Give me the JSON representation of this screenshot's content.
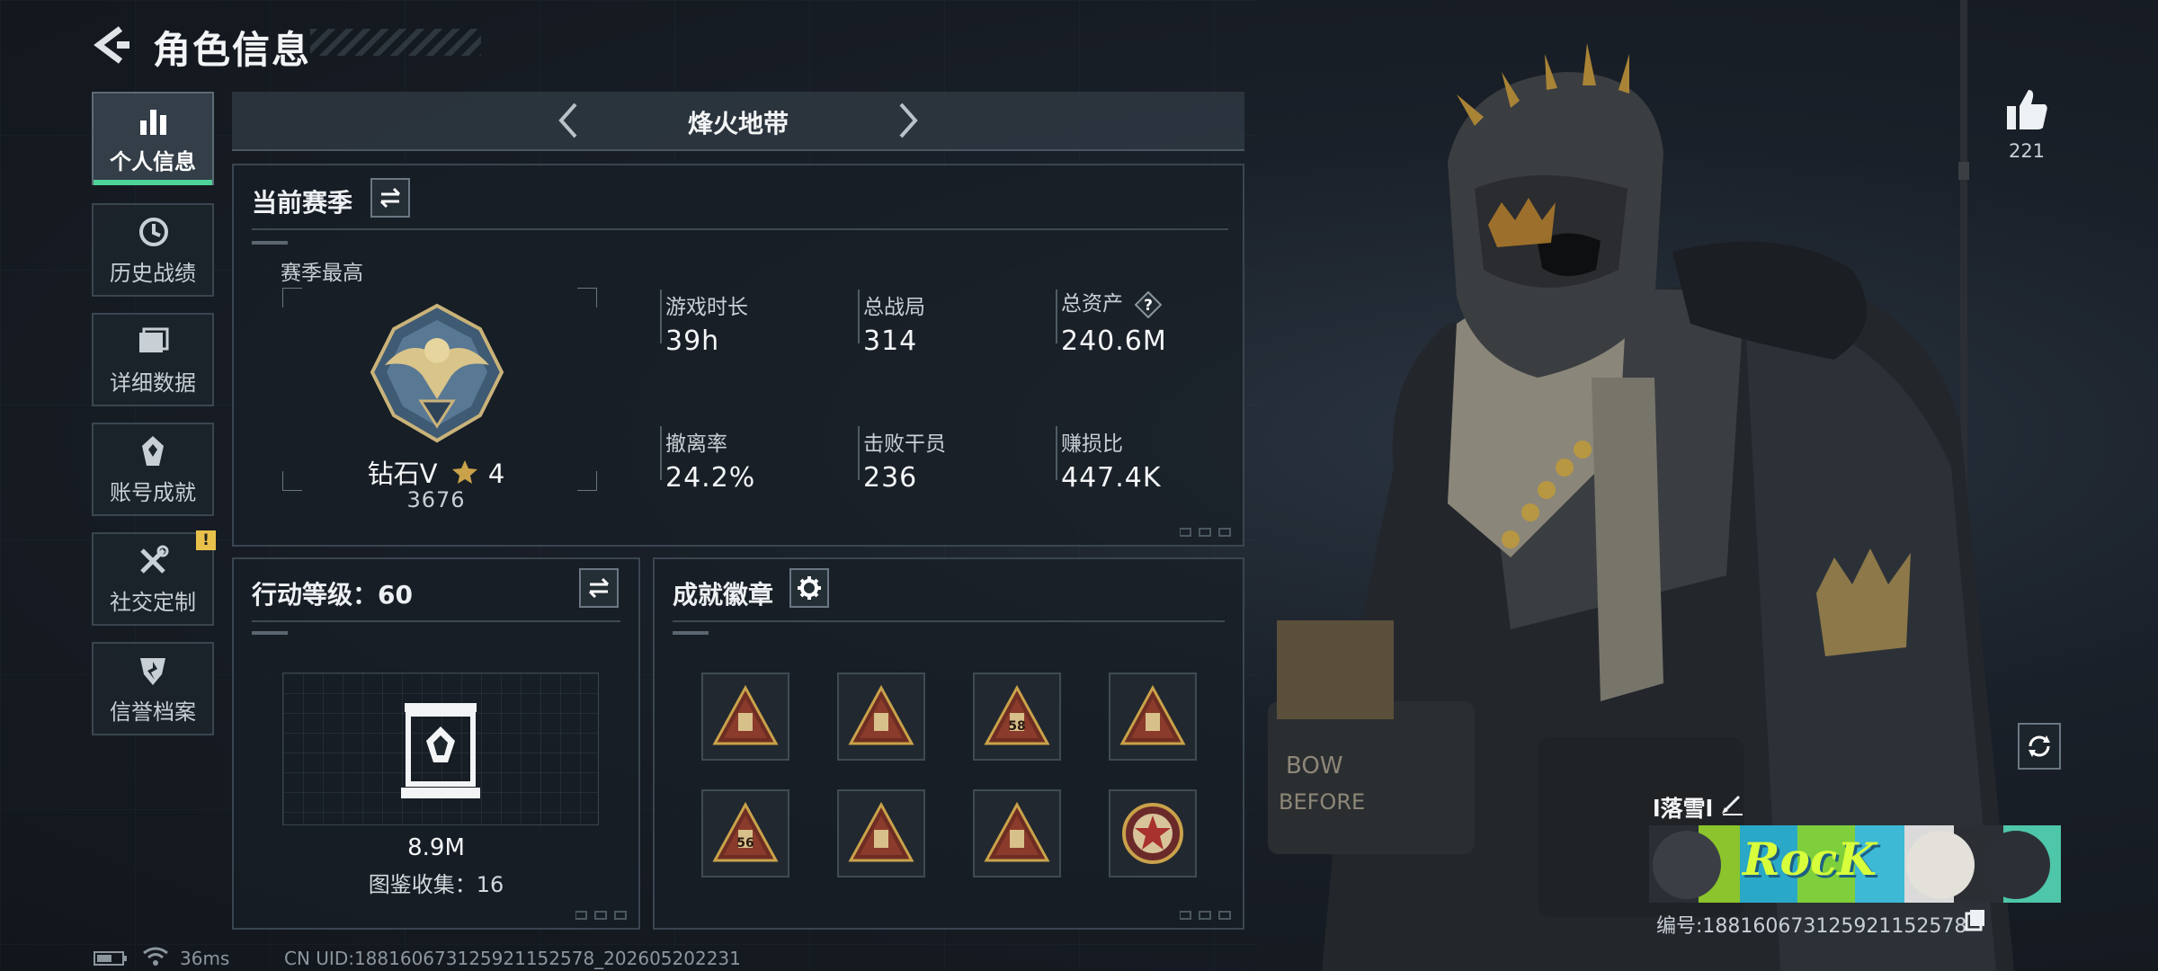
{
  "header": {
    "title": "角色信息"
  },
  "nav": {
    "items": [
      {
        "label": "个人信息",
        "icon": "bar-chart-icon",
        "active": true
      },
      {
        "label": "历史战绩",
        "icon": "clock-history-icon"
      },
      {
        "label": "详细数据",
        "icon": "folder-data-icon"
      },
      {
        "label": "账号成就",
        "icon": "achievement-icon"
      },
      {
        "label": "社交定制",
        "icon": "tools-icon",
        "badge": "!"
      },
      {
        "label": "信誉档案",
        "icon": "shield-icon"
      }
    ]
  },
  "mode": {
    "title": "烽火地带"
  },
  "season": {
    "title": "当前赛季",
    "best_label": "赛季最高",
    "rank_name": "钻石V",
    "rank_stars": "4",
    "rank_points": "3676",
    "stats": [
      {
        "label": "游戏时长",
        "value": "39h"
      },
      {
        "label": "总战局",
        "value": "314"
      },
      {
        "label": "总资产",
        "value": "240.6M",
        "help": "?"
      },
      {
        "label": "撤离率",
        "value": "24.2%"
      },
      {
        "label": "击败干员",
        "value": "236"
      },
      {
        "label": "赚损比",
        "value": "447.4K"
      }
    ]
  },
  "action_level": {
    "title": "行动等级：60",
    "value": "8.9M",
    "collection": "图鉴收集：16"
  },
  "achievements": {
    "title": "成就徽章",
    "badges": [
      "triangle-badge-icon",
      "triangle-badge-icon",
      "triangle-badge-icon",
      "triangle-badge-icon",
      "triangle-badge-icon",
      "triangle-badge-icon",
      "triangle-badge-icon",
      "round-star-badge-icon"
    ],
    "badge_labels": [
      "",
      "",
      "58",
      "",
      "56",
      "",
      "",
      ""
    ]
  },
  "profile": {
    "likes": "221",
    "player_name": "l落雪l",
    "banner_tag": "RocK",
    "player_id": "编号:1881606731259211525​78"
  },
  "status": {
    "ping": "36ms",
    "uid": "CN UID:1881606731259211525​78_202605202231"
  },
  "colors": {
    "accent": "#4fd39a",
    "warning": "#e8c14a",
    "gold": "#c9a24a"
  }
}
